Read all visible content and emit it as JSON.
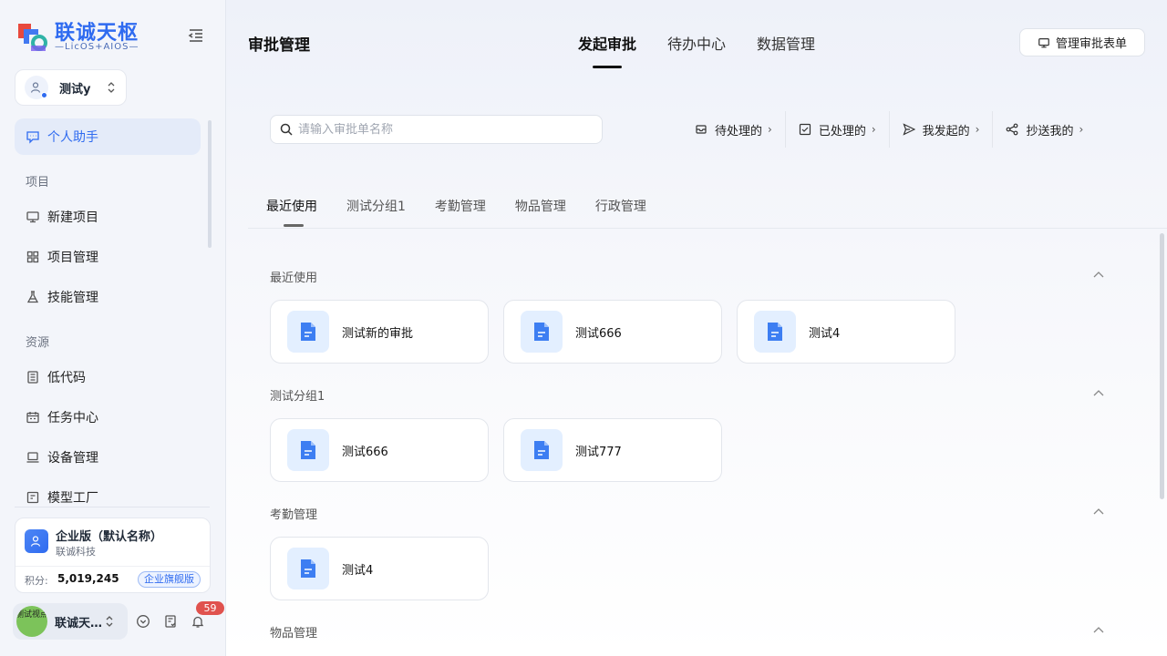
{
  "brand": {
    "name": "联诚天枢",
    "sub": "—LicOS+AIOS—"
  },
  "current_user": {
    "name": "测试y"
  },
  "nav": {
    "assistant": "个人助手",
    "section_project": "项目",
    "new_project": "新建项目",
    "project_manage": "项目管理",
    "skill_manage": "技能管理",
    "section_resource": "资源",
    "low_code": "低代码",
    "task_center": "任务中心",
    "device_manage": "设备管理",
    "model_factory": "模型工厂"
  },
  "plan": {
    "title": "企业版（默认名称）",
    "org": "联诚科技",
    "points_label": "积分:",
    "points": "5,019,245",
    "badge": "企业旗舰版"
  },
  "footer": {
    "avatar_text": "测试视点",
    "name": "联诚天…",
    "notifications": "59"
  },
  "header": {
    "title": "审批管理",
    "tabs": [
      "发起审批",
      "待办中心",
      "数据管理"
    ],
    "manage_button": "管理审批表单"
  },
  "search": {
    "placeholder": "请输入审批单名称",
    "value": ""
  },
  "filters": [
    "待处理的",
    "已处理的",
    "我发起的",
    "抄送我的"
  ],
  "category_tabs": [
    "最近使用",
    "测试分组1",
    "考勤管理",
    "物品管理",
    "行政管理"
  ],
  "groups": [
    {
      "title": "最近使用",
      "items": [
        "测试新的审批",
        "测试666",
        "测试4"
      ]
    },
    {
      "title": "测试分组1",
      "items": [
        "测试666",
        "测试777"
      ]
    },
    {
      "title": "考勤管理",
      "items": [
        "测试4"
      ]
    },
    {
      "title": "物品管理",
      "items": []
    }
  ],
  "colors": {
    "accent": "#2f6bf0",
    "icon_bg": "#e3efff",
    "badge_red": "#e0524e"
  }
}
